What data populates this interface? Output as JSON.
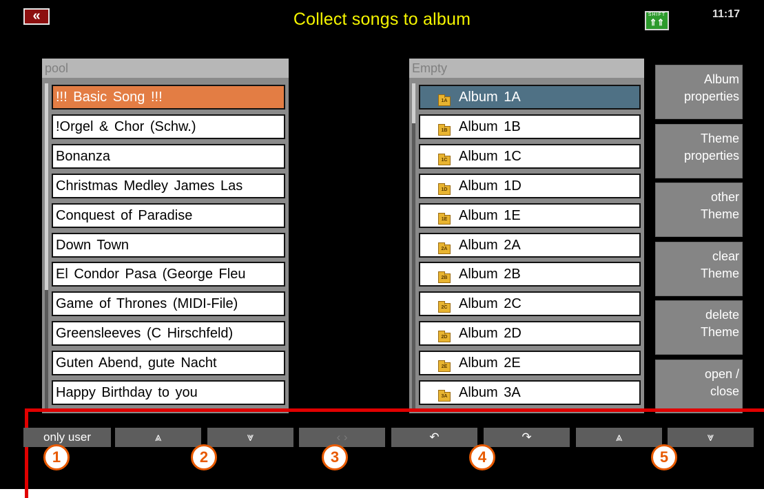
{
  "header": {
    "back_label": "«",
    "title": "Collect songs to album",
    "shift_top": "SHIFT",
    "shift_arrows": "⇑⇑",
    "clock": "11:17"
  },
  "pool": {
    "header": "pool",
    "songs": [
      "!!! Basic Song !!!",
      "!Orgel & Chor (Schw.)",
      "Bonanza",
      "Christmas Medley James Las",
      "Conquest of Paradise",
      "Down Town",
      "El Condor Pasa (George Fleu",
      "Game of Thrones (MIDI-File)",
      "Greensleeves (C Hirschfeld)",
      "Guten Abend, gute Nacht",
      "Happy Birthday to you"
    ]
  },
  "albums": {
    "header": "Empty",
    "items": [
      {
        "icon": "1A",
        "label": "Album 1A"
      },
      {
        "icon": "1B",
        "label": "Album 1B"
      },
      {
        "icon": "1C",
        "label": "Album 1C"
      },
      {
        "icon": "1D",
        "label": "Album 1D"
      },
      {
        "icon": "1E",
        "label": "Album 1E"
      },
      {
        "icon": "2A",
        "label": "Album 2A"
      },
      {
        "icon": "2B",
        "label": "Album 2B"
      },
      {
        "icon": "2C",
        "label": "Album 2C"
      },
      {
        "icon": "2D",
        "label": "Album 2D"
      },
      {
        "icon": "2E",
        "label": "Album 2E"
      },
      {
        "icon": "3A",
        "label": "Album 3A"
      }
    ]
  },
  "side_buttons": [
    {
      "line1": "Album",
      "line2": "properties"
    },
    {
      "line1": "Theme",
      "line2": "properties"
    },
    {
      "line1": "other",
      "line2": "Theme"
    },
    {
      "line1": "clear",
      "line2": "Theme"
    },
    {
      "line1": "delete",
      "line2": "Theme"
    },
    {
      "line1": "open /",
      "line2": "close"
    }
  ],
  "bottom_buttons": [
    {
      "label": "only user"
    },
    {
      "label": "⩓"
    },
    {
      "label": "⩔"
    },
    {
      "label": "‹ ›"
    },
    {
      "label": "↶"
    },
    {
      "label": "↷"
    },
    {
      "label": "⩓"
    },
    {
      "label": "⩔"
    }
  ],
  "badges": [
    "1",
    "2",
    "3",
    "4",
    "5"
  ],
  "colors": {
    "title": "#f5f500",
    "selected_pool": "#e37d44",
    "selected_album": "#4f7185",
    "annotation": "#e00000",
    "badge": "#e85a00"
  }
}
